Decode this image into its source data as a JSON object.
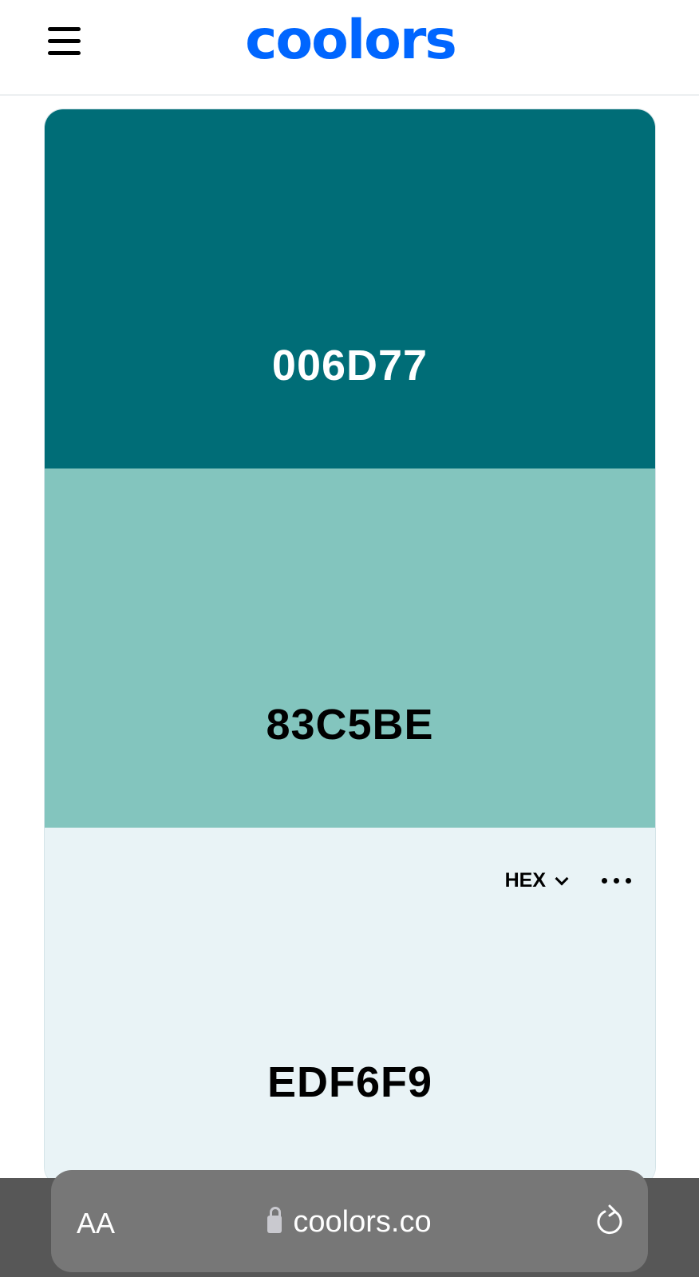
{
  "header": {
    "logo": "coolors"
  },
  "palette": [
    {
      "hex": "006D77",
      "color": "#006d77",
      "text_color": "#ffffff"
    },
    {
      "hex": "83C5BE",
      "color": "#83c5be",
      "text_color": "#000000"
    },
    {
      "hex": "EDF6F9",
      "color": "#e9f3f6",
      "text_color": "#000000"
    }
  ],
  "toolbar": {
    "format": "HEX"
  },
  "browser": {
    "text_size": "AA",
    "url": "coolors.co"
  }
}
